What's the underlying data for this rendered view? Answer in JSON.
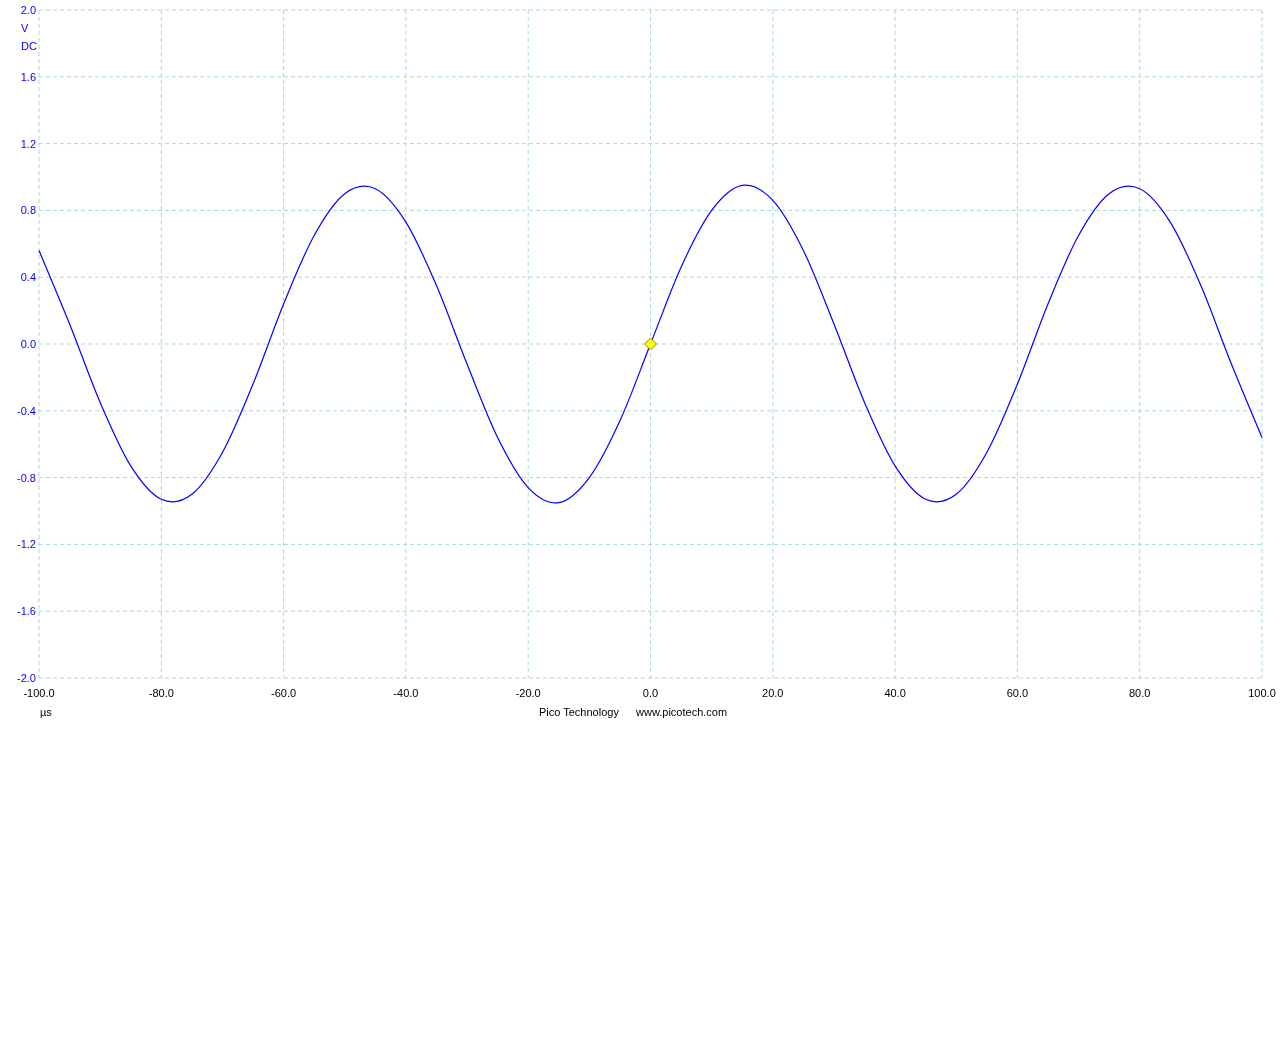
{
  "scope": {
    "chart_data": {
      "type": "line",
      "x": [
        -100,
        -95,
        -90,
        -85,
        -80,
        -75,
        -70,
        -65,
        -60,
        -55,
        -50,
        -45,
        -40,
        -35,
        -30,
        -25,
        -20,
        -15,
        -10,
        -5,
        0,
        5,
        10,
        15,
        20,
        25,
        30,
        35,
        40,
        45,
        50,
        55,
        60,
        65,
        70,
        75,
        80,
        85,
        90,
        95,
        100
      ],
      "grid": true,
      "series": [
        {
          "color": "#0000ff",
          "values": [
            0.56,
            0.12,
            -0.35,
            -0.73,
            -0.93,
            -0.9,
            -0.65,
            -0.24,
            0.24,
            0.65,
            0.9,
            0.93,
            0.73,
            0.35,
            -0.12,
            -0.56,
            -0.86,
            -0.95,
            -0.8,
            -0.46,
            0,
            0.46,
            0.8,
            0.95,
            0.86,
            0.56,
            0.12,
            -0.35,
            -0.73,
            -0.93,
            -0.9,
            -0.65,
            -0.24,
            0.24,
            0.65,
            0.9,
            0.93,
            0.73,
            0.35,
            -0.12,
            -0.56
          ]
        }
      ],
      "xlim": [
        -100,
        100
      ],
      "ylim": [
        -2,
        2
      ],
      "xticks": [
        {
          "value": -100,
          "label": "-100.0"
        },
        {
          "value": -80,
          "label": "-80.0"
        },
        {
          "value": -60,
          "label": "-60.0"
        },
        {
          "value": -40,
          "label": "-40.0"
        },
        {
          "value": -20,
          "label": "-20.0"
        },
        {
          "value": 0,
          "label": "0.0"
        },
        {
          "value": 20,
          "label": "20.0"
        },
        {
          "value": 40,
          "label": "40.0"
        },
        {
          "value": 60,
          "label": "60.0"
        },
        {
          "value": 80,
          "label": "80.0"
        },
        {
          "value": 100,
          "label": "100.0"
        }
      ],
      "yticks": [
        {
          "value": 2,
          "label": "2.0"
        },
        {
          "value": 1.6,
          "label": "1.6"
        },
        {
          "value": 1.2,
          "label": "1.2"
        },
        {
          "value": 0.8,
          "label": "0.8"
        },
        {
          "value": 0.4,
          "label": "0.4"
        },
        {
          "value": 0,
          "label": "0.0"
        },
        {
          "value": -0.4,
          "label": "-0.4"
        },
        {
          "value": -0.8,
          "label": "-0.8"
        },
        {
          "value": -1.2,
          "label": "-1.2"
        },
        {
          "value": -1.6,
          "label": "-1.6"
        },
        {
          "value": -2,
          "label": "-2.0"
        }
      ]
    },
    "y_unit": "V",
    "coupling": "DC",
    "x_unit": "µs"
  },
  "footer": {
    "company": "Pico Technology",
    "website": "www.picotech.com"
  }
}
